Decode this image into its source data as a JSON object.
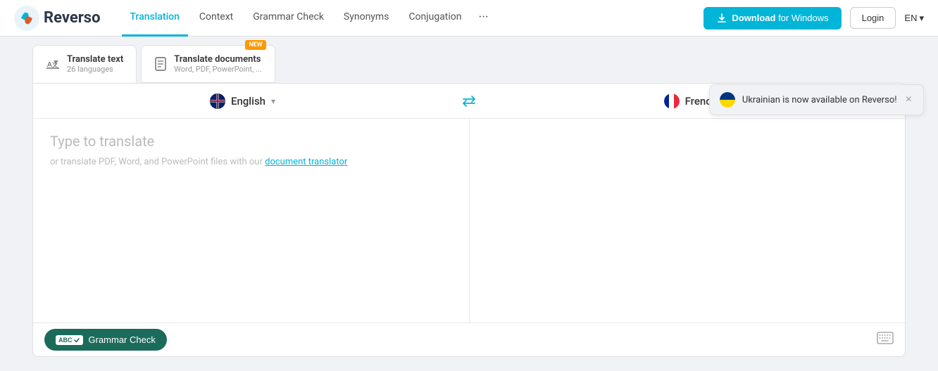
{
  "header": {
    "logo_text": "Reverso",
    "nav_items": [
      {
        "label": "Translation",
        "active": true
      },
      {
        "label": "Context",
        "active": false
      },
      {
        "label": "Grammar Check",
        "active": false
      },
      {
        "label": "Synonyms",
        "active": false
      },
      {
        "label": "Conjugation",
        "active": false
      },
      {
        "label": "···",
        "active": false
      }
    ],
    "download_label": "Download",
    "download_suffix": "for Windows",
    "login_label": "Login",
    "lang_label": "EN"
  },
  "tabs": [
    {
      "icon": "translate-icon",
      "title": "Translate text",
      "subtitle": "26 languages",
      "active": true,
      "new_badge": false
    },
    {
      "icon": "document-icon",
      "title": "Translate documents",
      "subtitle": "Word, PDF, PowerPoint, ...",
      "active": false,
      "new_badge": true
    }
  ],
  "notification": {
    "text": "Ukrainian is now available on Reverso!",
    "close_label": "×"
  },
  "translation": {
    "source_lang": "English",
    "target_lang": "French",
    "placeholder_main": "Type to translate",
    "placeholder_sub_prefix": "or translate PDF, Word, and PowerPoint files with our ",
    "placeholder_sub_link": "document translator",
    "grammar_check_label": "Grammar Check"
  }
}
